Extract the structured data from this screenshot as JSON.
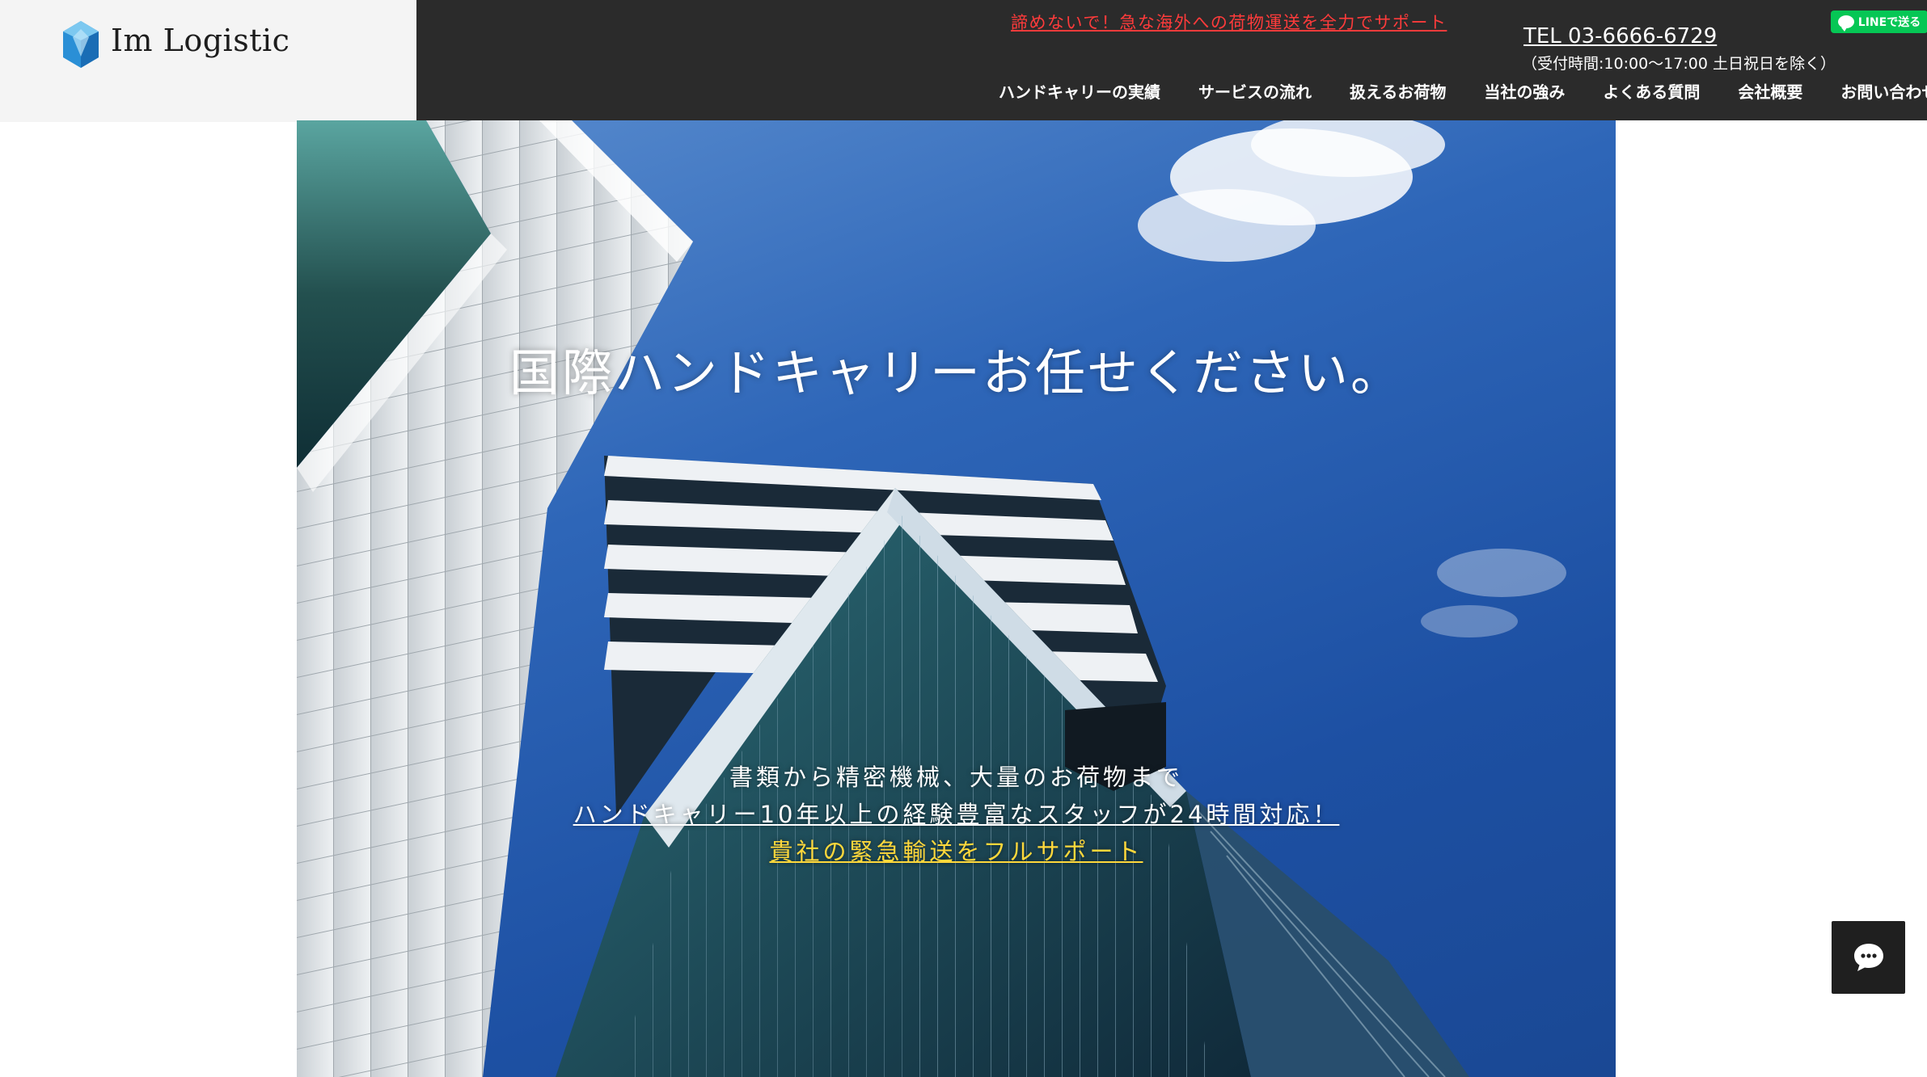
{
  "brand": {
    "name": "Im Logistic",
    "logo_icon": "blue-hexagon-crystal-icon",
    "accent_color": "#2a8fd6"
  },
  "header": {
    "promo_text": "諦めないで！急な海外への荷物運送を全力でサポート",
    "promo_color": "#ff3b3b",
    "tel": "TEL 03-6666-6729",
    "hours": "（受付時間:10:00～17:00 土日祝日を除く）",
    "line_button_label": "LINEで送る",
    "line_color": "#06c755",
    "bar_color": "#2b2b2b"
  },
  "nav": {
    "items": [
      {
        "label": "ハンドキャリーの実績"
      },
      {
        "label": "サービスの流れ"
      },
      {
        "label": "扱えるお荷物"
      },
      {
        "label": "当社の強み"
      },
      {
        "label": "よくある質問"
      },
      {
        "label": "会社概要"
      },
      {
        "label": "お問い合わせ"
      }
    ]
  },
  "hero": {
    "title": "国際ハンドキャリーお任せください。",
    "line1": "書類から精密機械、大量のお荷物まで",
    "line2": "ハンドキャリー10年以上の経験豊富なスタッフが24時間対応！",
    "line3": "貴社の緊急輸送をフルサポート",
    "highlight_color": "#ffd83b",
    "background": "skyscraper-against-blue-sky-photo"
  },
  "chat": {
    "icon": "chat-bubble-icon"
  }
}
